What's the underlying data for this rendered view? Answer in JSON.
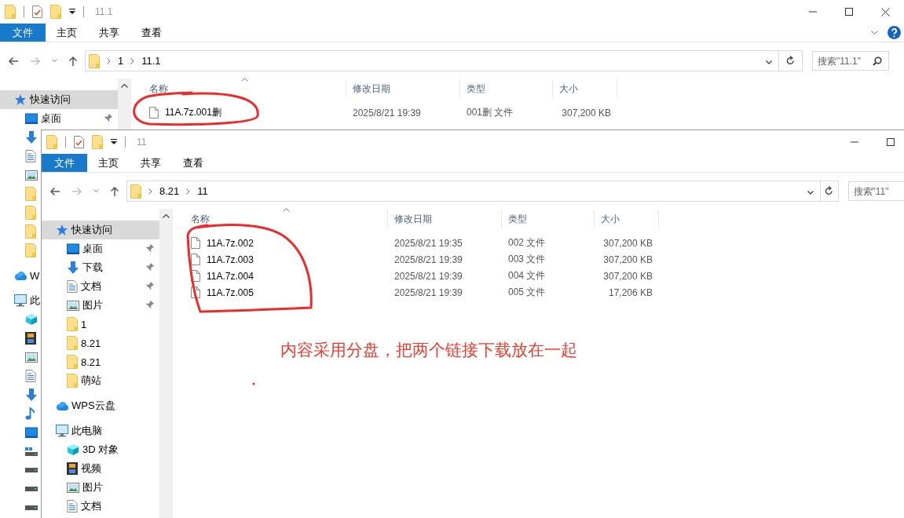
{
  "windows": [
    {
      "title": "11.1",
      "controls": [
        {
          "kind": "minimize"
        },
        {
          "kind": "maximize"
        },
        {
          "kind": "close"
        }
      ],
      "ribbon_tabs": [
        {
          "label": "文件",
          "selected": true
        },
        {
          "label": "主页",
          "selected": false
        },
        {
          "label": "共享",
          "selected": false
        },
        {
          "label": "查看",
          "selected": false
        }
      ],
      "ribbon_icons": [
        {
          "kind": "expand"
        },
        {
          "kind": "help"
        }
      ],
      "path": [
        "1",
        "11.1"
      ],
      "search": {
        "placeholder": "搜索\"11.1\"",
        "icon": true
      },
      "nav": [
        {
          "label": "快速访问",
          "kind": "star",
          "selected": true,
          "children": [
            {
              "label": "桌面",
              "kind": "desktop",
              "selected": false,
              "pinned": true
            },
            {
              "kind": "download",
              "selected": false
            },
            {
              "kind": "document",
              "selected": false
            },
            {
              "kind": "picture",
              "selected": false
            },
            {
              "kind": "folder",
              "selected": false
            },
            {
              "kind": "folder",
              "selected": false
            },
            {
              "kind": "folder",
              "selected": false
            },
            {
              "kind": "folder",
              "selected": false
            }
          ]
        },
        {
          "label": "W",
          "kind": "cloud",
          "selected": false
        },
        {
          "label": "此",
          "kind": "pc",
          "selected": false,
          "children": [
            {
              "kind": "cube",
              "selected": false
            },
            {
              "kind": "film",
              "selected": false
            },
            {
              "kind": "picture",
              "selected": false
            },
            {
              "kind": "document",
              "selected": false
            },
            {
              "kind": "download",
              "selected": false
            },
            {
              "kind": "music",
              "selected": false
            },
            {
              "kind": "desktop",
              "selected": false
            },
            {
              "kind": "windrive",
              "selected": false
            },
            {
              "kind": "drive",
              "selected": false
            },
            {
              "kind": "drive",
              "selected": false
            },
            {
              "kind": "drive",
              "selected": false
            }
          ]
        }
      ],
      "columns": [
        "名称",
        "修改日期",
        "类型",
        "大小"
      ],
      "files": [
        {
          "name": "11A.7z.001删",
          "modified": "2025/8/21 19:39",
          "type": "001删 文件",
          "size": "307,200 KB"
        }
      ]
    },
    {
      "title": "11",
      "controls": [
        {
          "kind": "minimize"
        },
        {
          "kind": "maximize"
        }
      ],
      "ribbon_tabs": [
        {
          "label": "文件",
          "selected": true
        },
        {
          "label": "主页",
          "selected": false
        },
        {
          "label": "共享",
          "selected": false
        },
        {
          "label": "查看",
          "selected": false
        }
      ],
      "path": [
        "8.21",
        "11"
      ],
      "search": {
        "placeholder": "搜索\"11\"",
        "icon": false
      },
      "nav": [
        {
          "label": "快速访问",
          "kind": "star",
          "selected": true,
          "children": [
            {
              "label": "桌面",
              "kind": "desktop",
              "selected": false,
              "pinned": true
            },
            {
              "label": "下载",
              "kind": "download",
              "selected": false,
              "pinned": true
            },
            {
              "label": "文档",
              "kind": "document",
              "selected": false,
              "pinned": true
            },
            {
              "label": "图片",
              "kind": "picture",
              "selected": false,
              "pinned": true
            },
            {
              "label": "1",
              "kind": "folder",
              "selected": false,
              "pinned": false
            },
            {
              "label": "8.21",
              "kind": "folder",
              "selected": false,
              "pinned": false
            },
            {
              "label": "8.21",
              "kind": "folder",
              "selected": false,
              "pinned": false
            },
            {
              "label": "萌站",
              "kind": "folder",
              "selected": false,
              "pinned": false
            }
          ]
        },
        {
          "label": "WPS云盘",
          "kind": "cloud",
          "selected": false
        },
        {
          "label": "此电脑",
          "kind": "pc",
          "selected": false,
          "children": [
            {
              "label": "3D 对象",
              "kind": "cube",
              "selected": false
            },
            {
              "label": "视频",
              "kind": "film",
              "selected": false
            },
            {
              "label": "图片",
              "kind": "picture",
              "selected": false
            },
            {
              "label": "文档",
              "kind": "document",
              "selected": false
            }
          ]
        }
      ],
      "columns": [
        "名称",
        "修改日期",
        "类型",
        "大小"
      ],
      "files": [
        {
          "name": "11A.7z.002",
          "modified": "2025/8/21 19:35",
          "type": "002 文件",
          "size": "307,200 KB"
        },
        {
          "name": "11A.7z.003",
          "modified": "2025/8/21 19:39",
          "type": "003 文件",
          "size": "307,200 KB"
        },
        {
          "name": "11A.7z.004",
          "modified": "2025/8/21 19:39",
          "type": "004 文件",
          "size": "307,200 KB"
        },
        {
          "name": "11A.7z.005",
          "modified": "2025/8/21 19:39",
          "type": "005 文件",
          "size": "17,206 KB"
        }
      ]
    }
  ],
  "annotation": {
    "note": "内容采用分盘，把两个链接下载放在一起"
  }
}
